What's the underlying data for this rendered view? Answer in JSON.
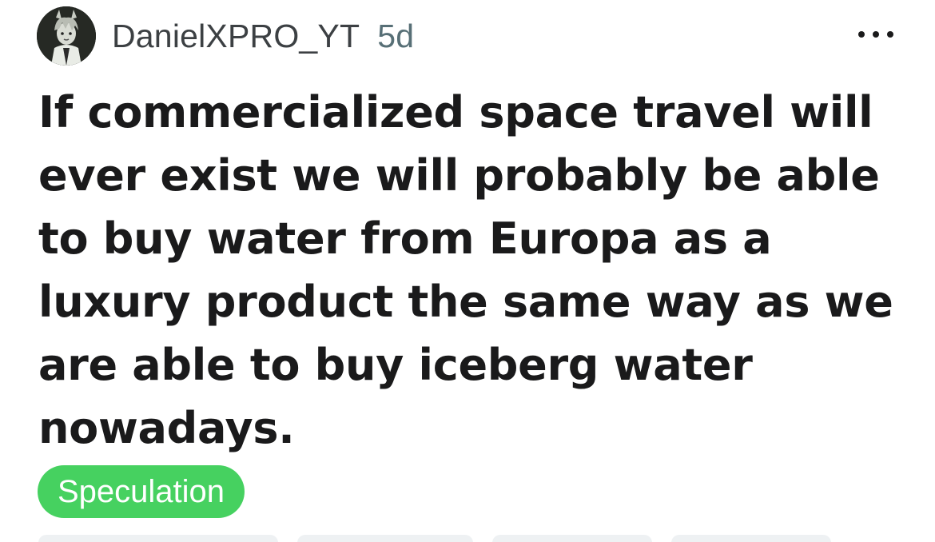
{
  "post": {
    "author": "DanielXPRO_YT",
    "age": "5d",
    "title": "If commercialized space travel will ever exist we will probably be able to buy water from Europa as a luxury product the same way as we are able to buy iceberg water nowadays.",
    "flair": "Speculation"
  },
  "colors": {
    "flair_background": "#46d160",
    "flair_text": "#ffffff",
    "title_text": "#1a1a1b",
    "meta_text": "#576f76"
  },
  "icons": {
    "more": "more-horizontal-icon",
    "avatar": "user-avatar"
  }
}
